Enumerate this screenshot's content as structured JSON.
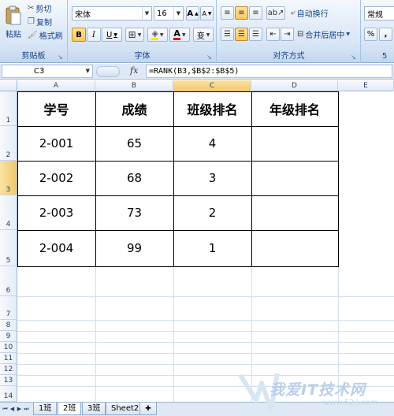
{
  "ribbon": {
    "clipboard": {
      "paste_label": "粘贴",
      "cut_label": "剪切",
      "copy_label": "复制",
      "format_painter_label": "格式刷",
      "group_label": "剪贴板"
    },
    "font": {
      "font_name": "宋体",
      "font_size": "16",
      "grow_label": "A",
      "shrink_label": "A",
      "bold_label": "B",
      "italic_label": "I",
      "underline_label": "U",
      "font_color_label": "A",
      "phonetic_label": "变",
      "group_label": "字体"
    },
    "alignment": {
      "wrap_text_label": "自动换行",
      "merge_center_label": "合并后居中",
      "group_label": "对齐方式"
    },
    "number": {
      "format_value": "常规",
      "currency_label": "%",
      "comma_label": ",",
      "group_label": "5"
    }
  },
  "formula_bar": {
    "name_box": "C3",
    "fx_label": "fx",
    "formula": "=RANK(B3,$B$2:$B$5)"
  },
  "columns": [
    "A",
    "B",
    "C",
    "D",
    "E"
  ],
  "rows": [
    "1",
    "2",
    "3",
    "4",
    "5",
    "6",
    "7",
    "8",
    "9",
    "10",
    "11",
    "12",
    "13",
    "14"
  ],
  "table": {
    "headers": [
      "学号",
      "成绩",
      "班级排名",
      "年级排名"
    ],
    "rows": [
      [
        "2-001",
        "65",
        "4",
        ""
      ],
      [
        "2-002",
        "68",
        "3",
        ""
      ],
      [
        "2-003",
        "73",
        "2",
        ""
      ],
      [
        "2-004",
        "99",
        "1",
        ""
      ]
    ]
  },
  "sheet_tabs": {
    "tabs": [
      "1班",
      "2班",
      "3班",
      "Sheet2"
    ],
    "active_index": 1
  },
  "watermark": {
    "text": "我爱IT技术网",
    "url": "www.52ij.com"
  },
  "colors": {
    "accent_selected": "#f2c76a",
    "ribbon_text": "#15428b"
  }
}
